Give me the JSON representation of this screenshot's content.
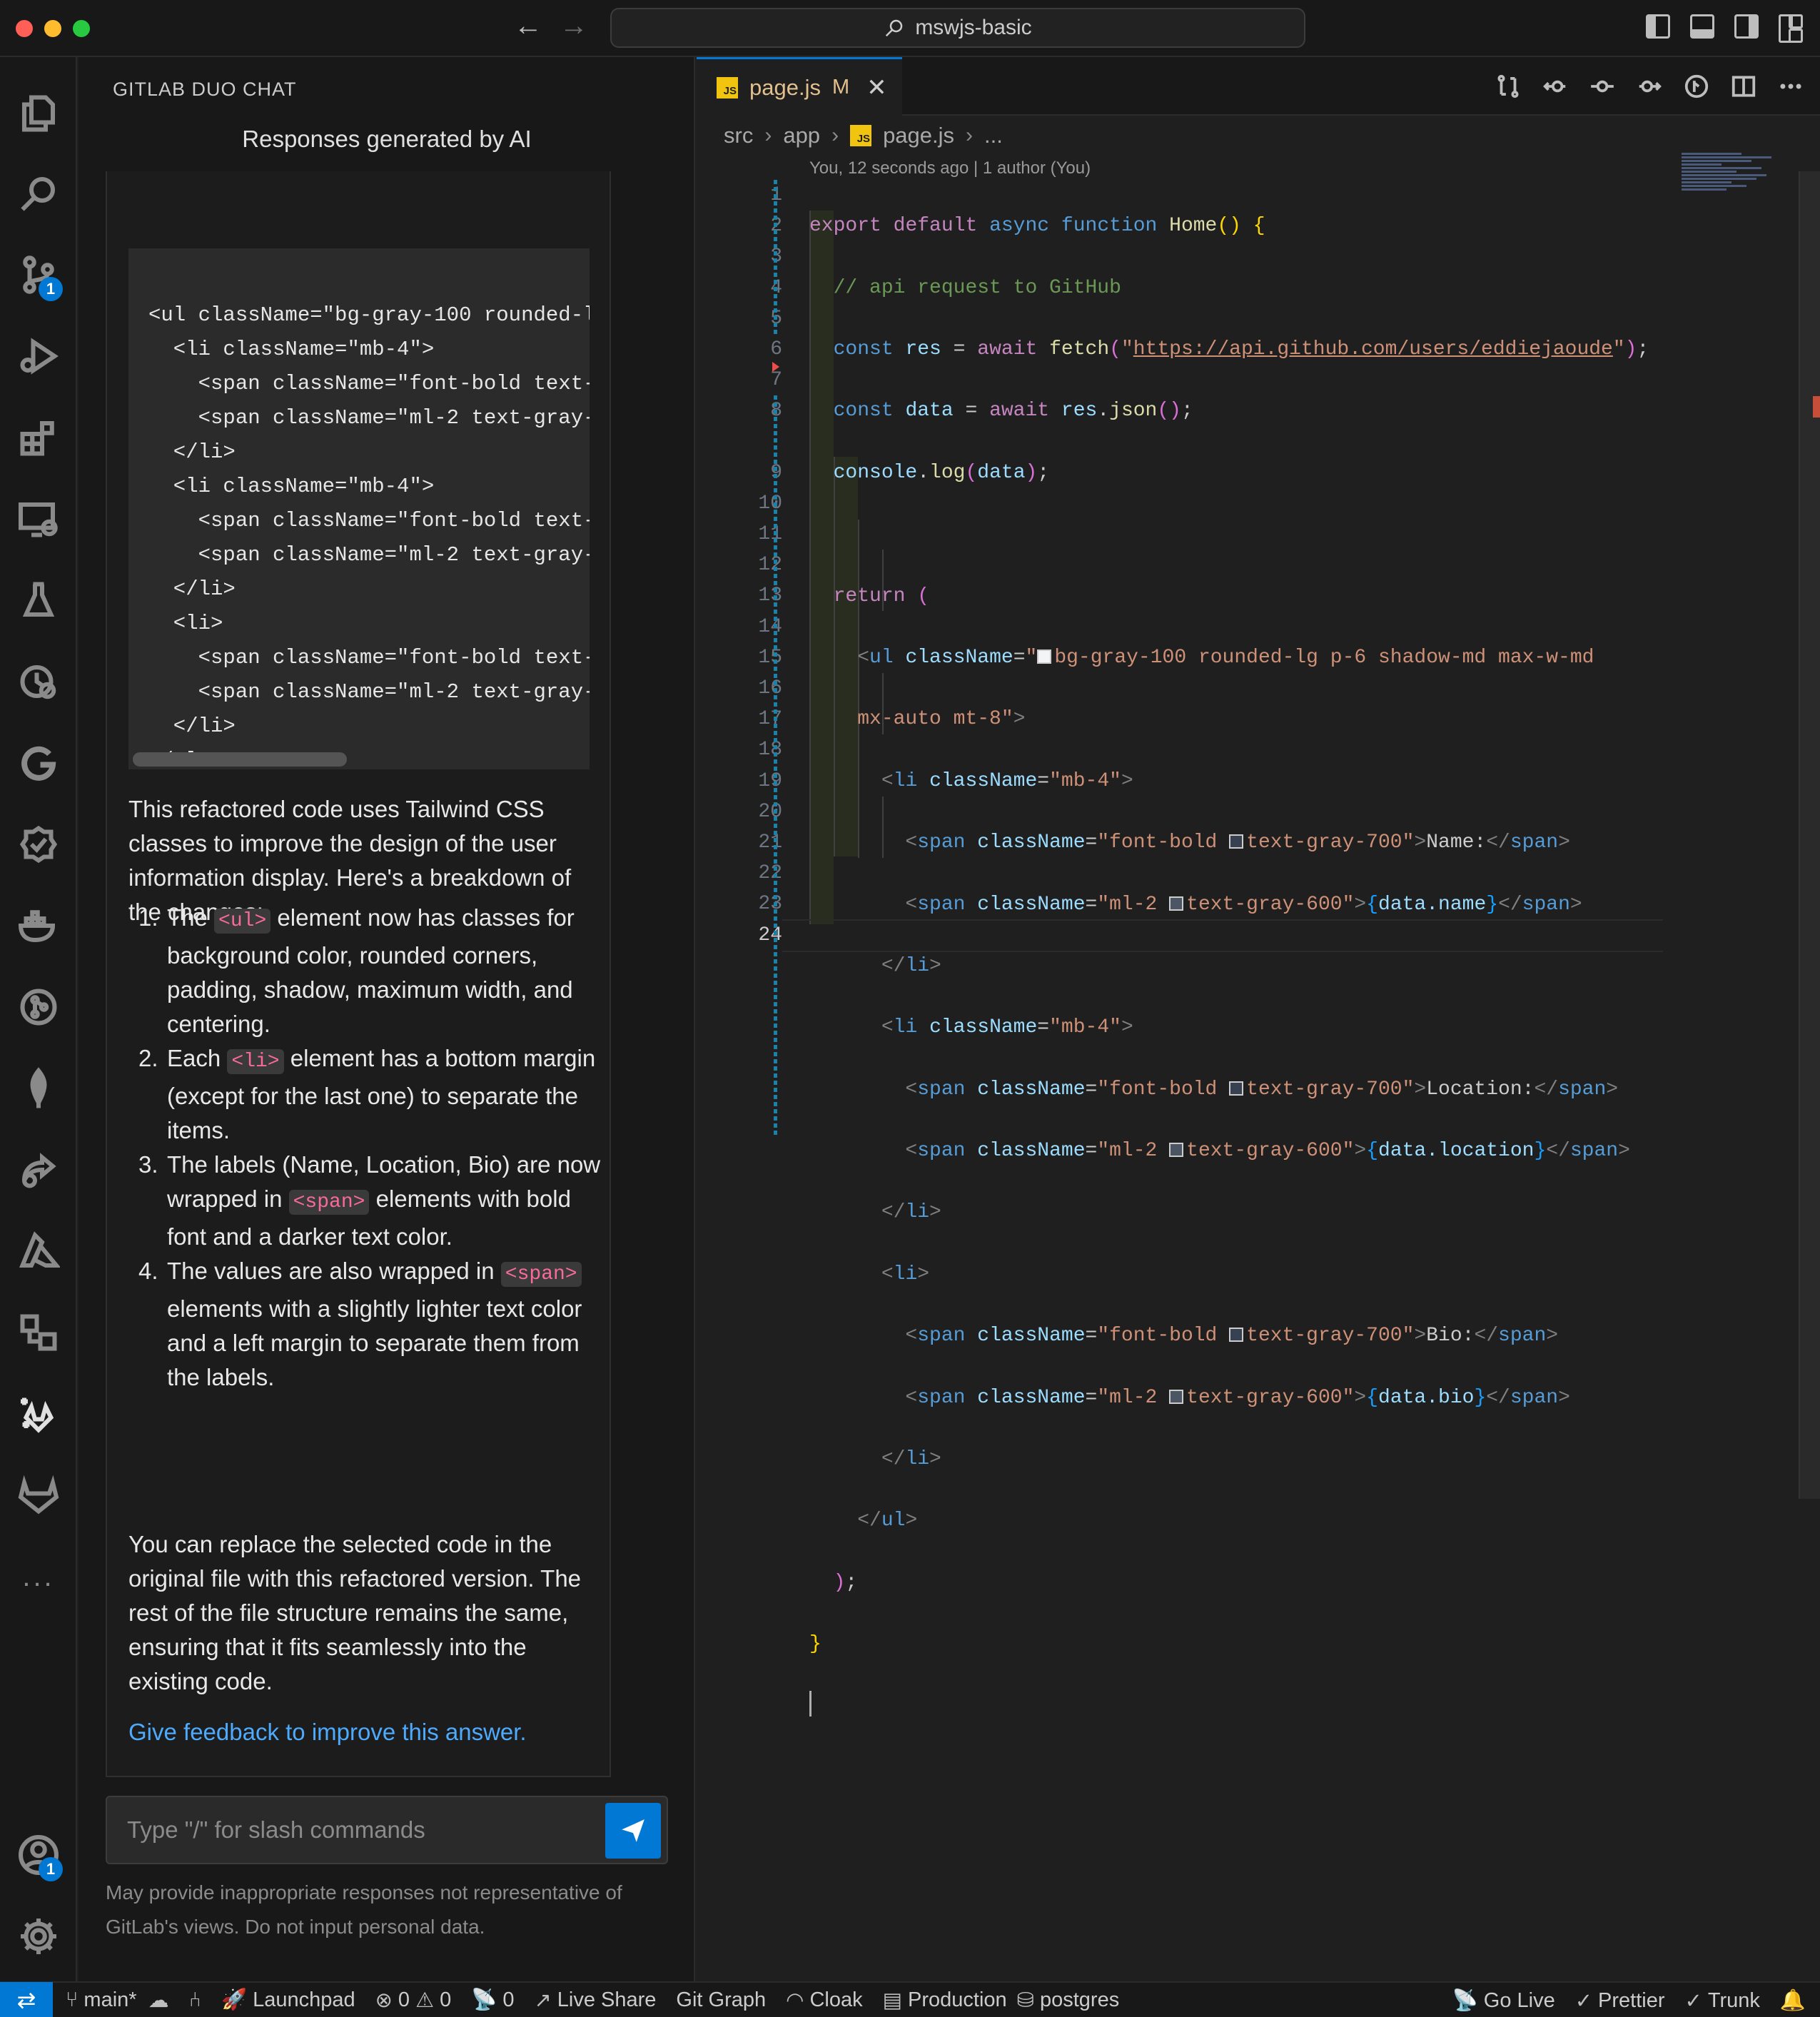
{
  "window": {
    "search_title": "mswjs-basic"
  },
  "activity_bar": {
    "icons": [
      "files-icon",
      "search-icon",
      "source-control-icon",
      "run-debug-icon",
      "extensions-icon",
      "remote-explorer-icon",
      "testing-icon",
      "timeline-icon",
      "gitlab-workflow-icon",
      "check-icon",
      "docker-icon",
      "git-graph-icon",
      "mongodb-icon",
      "live-share-icon",
      "azure-icon",
      "container-icon",
      "duo-chat-icon",
      "gitlab-icon",
      "more-icon",
      "account-icon",
      "settings-icon"
    ],
    "source_control_badge": "1",
    "account_badge": "1",
    "more_label": "..."
  },
  "chat": {
    "panel_title": "GITLAB DUO CHAT",
    "responses_label": "Responses generated by AI",
    "code_lines": [
      "<ul className=\"bg-gray-100 rounded-l",
      "  <li className=\"mb-4\">",
      "    <span className=\"font-bold text-",
      "    <span className=\"ml-2 text-gray-",
      "  </li>",
      "  <li className=\"mb-4\">",
      "    <span className=\"font-bold text-",
      "    <span className=\"ml-2 text-gray-",
      "  </li>",
      "  <li>",
      "    <span className=\"font-bold text-",
      "    <span className=\"ml-2 text-gray-",
      "  </li>",
      "</ul>"
    ],
    "intro": "This refactored code uses Tailwind CSS classes to improve the design of the user information display. Here's a breakdown of the changes:",
    "list": [
      {
        "num": "1.",
        "before": "The ",
        "code": "<ul>",
        "after": " element now has classes for background color, rounded corners, padding, shadow, maximum width, and centering."
      },
      {
        "num": "2.",
        "before": "Each ",
        "code": "<li>",
        "after": " element has a bottom margin (except for the last one) to separate the items."
      },
      {
        "num": "3.",
        "before": "The labels (Name, Location, Bio) are now wrapped in ",
        "code": "<span>",
        "after": " elements with bold font and a darker text color."
      },
      {
        "num": "4.",
        "before": "The values are also wrapped in ",
        "code": "<span>",
        "after": " elements with a slightly lighter text color and a left margin to separate them from the labels."
      }
    ],
    "outro": "You can replace the selected code in the original file with this refactored version. The rest of the file structure remains the same, ensuring that it fits seamlessly into the existing code.",
    "feedback_link": "Give feedback to improve this answer.",
    "input_placeholder": "Type \"/\" for slash commands",
    "disclaimer": "May provide inappropriate responses not representative of GitLab's views. Do not input personal data."
  },
  "editor": {
    "tab": {
      "name": "page.js",
      "status": "M",
      "icon_label": "JS"
    },
    "breadcrumb": [
      "src",
      "app",
      "page.js",
      "..."
    ],
    "blame": "You, 12 seconds ago | 1 author (You)",
    "line_numbers": [
      "1",
      "2",
      "3",
      "4",
      "5",
      "6",
      "7",
      "8",
      "",
      "9",
      "10",
      "11",
      "12",
      "13",
      "14",
      "15",
      "16",
      "17",
      "18",
      "19",
      "20",
      "21",
      "22",
      "23",
      "24"
    ],
    "code": {
      "l1_export": "export",
      "l1_default": "default",
      "l1_async": "async",
      "l1_function": "function",
      "l1_name": "Home",
      "l2_comment": "// api request to GitHub",
      "l3_const": "const",
      "l3_res": "res",
      "l3_await": "await",
      "l3_fetch": "fetch",
      "l3_url": "https://api.github.com/users/eddiejaoude",
      "l4_const": "const",
      "l4_data": "data",
      "l4_await": "await",
      "l4_res": "res",
      "l4_json": "json",
      "l5_console": "console",
      "l5_log": "log",
      "l5_data": "data",
      "l7_return": "return",
      "ul_tag": "ul",
      "li_tag": "li",
      "span_tag": "span",
      "classname_attr": "className",
      "l8_class_a": "bg-gray-100 rounded-lg p-6 shadow-md max-w-md",
      "l8_class_b": "mx-auto mt-8",
      "li_class": "mb-4",
      "bold_class": "font-bold ",
      "bold_color": "text-gray-700",
      "val_class": "ml-2 ",
      "val_color": "text-gray-600",
      "label_name": "Name:",
      "label_location": "Location:",
      "label_bio": "Bio:",
      "expr_name": "data.name",
      "expr_location": "data.location",
      "expr_bio": "data.bio"
    }
  },
  "status_bar": {
    "branch": "main*",
    "launchpad": "Launchpad",
    "errors": "0",
    "warnings": "0",
    "ports": "0",
    "live_share": "Live Share",
    "git_graph": "Git Graph",
    "cloak": "Cloak",
    "production": "Production",
    "postgres": "postgres",
    "go_live": "Go Live",
    "prettier": "Prettier",
    "trunk": "Trunk"
  },
  "colors": {
    "accent": "#0078d4",
    "link": "#4daafc",
    "modified": "#e2c08d"
  }
}
